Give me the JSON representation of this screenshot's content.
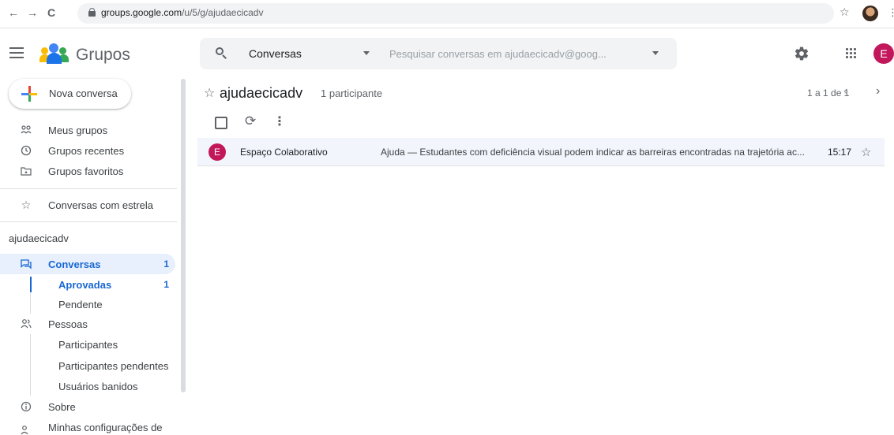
{
  "browser": {
    "url_host": "groups.google.com",
    "url_path": "/u/5/g/ajudaecicadv",
    "back_glyph": "←",
    "forward_glyph": "→",
    "reload_glyph": "C",
    "star_glyph": "☆",
    "kebab_glyph": "⋮"
  },
  "header": {
    "brand": "Grupos",
    "search_scope": "Conversas",
    "search_placeholder": "Pesquisar conversas em ajudaecicadv@goog...",
    "user_initial": "E"
  },
  "sidebar": {
    "new_button": "Nova conversa",
    "top_items": [
      {
        "label": "Meus grupos",
        "icon": "groups-icon"
      },
      {
        "label": "Grupos recentes",
        "icon": "clock-icon"
      },
      {
        "label": "Grupos favoritos",
        "icon": "folder-star-icon"
      }
    ],
    "starred": "Conversas com estrela",
    "group_section": "ajudaecicadv",
    "conversations": {
      "label": "Conversas",
      "count": "1"
    },
    "approved": {
      "label": "Aprovadas",
      "count": "1"
    },
    "pending": "Pendente",
    "people": "Pessoas",
    "members": "Participantes",
    "pending_members": "Participantes pendentes",
    "banned": "Usuários banidos",
    "about": "Sobre",
    "settings": "Minhas configurações de"
  },
  "main": {
    "group_name": "ajudaecicadv",
    "participants": "1 participante",
    "pagination": "1 a 1 de 1",
    "rows": [
      {
        "avatar": "E",
        "title": "Espaço Colaborativo",
        "snippet": "Ajuda — Estudantes com deficiência visual podem indicar as barreiras encontradas na trajetória ac...",
        "time": "15:17"
      }
    ]
  },
  "colors": {
    "accent": "#1967d2",
    "avatar": "#c2185b",
    "active_bg": "#e8f0fe"
  }
}
